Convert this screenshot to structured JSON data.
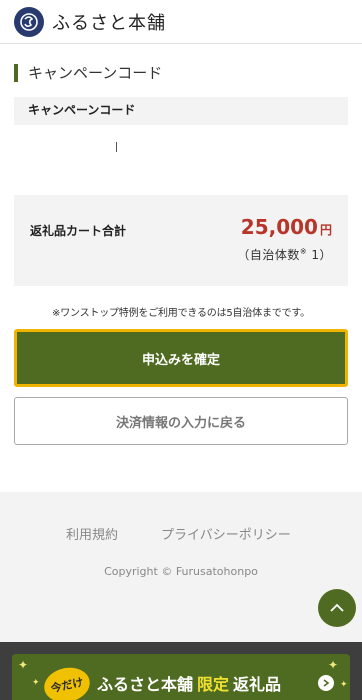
{
  "header": {
    "logo_text": "ふるさと本舗",
    "logo_mark": "furusato-logo-icon"
  },
  "campaign": {
    "section_title": "キャンペーンコード",
    "field_label": "キャンペーンコード",
    "input_value": ""
  },
  "total": {
    "label": "返礼品カート合計",
    "amount": "25,000",
    "currency": "円",
    "count_prefix": "（自治体数",
    "count_mark": "※",
    "count_value": "1）"
  },
  "note": "※ワンストップ特例をご利用できるのは5自治体までです。",
  "buttons": {
    "confirm_label": "申込みを確定",
    "back_label": "決済情報の入力に戻る"
  },
  "footer": {
    "terms_label": "利用規約",
    "privacy_label": "プライバシーポリシー",
    "copyright": "Copyright © Furusatohonpo"
  },
  "banner": {
    "badge": "今だけ",
    "text_before": "ふるさと本舗",
    "text_highlight": "限定",
    "text_after": "返礼品"
  },
  "colors": {
    "accent_green": "#4f6b21",
    "confirm_border": "#f0b400",
    "price_red": "#b8352a",
    "logo_navy": "#283a6e",
    "banner_yellow": "#f0e130"
  },
  "icons": {
    "pagetop": "chevron-up-icon",
    "banner_arrow": "chevron-right-icon",
    "sparkle": "sparkle-icon"
  }
}
